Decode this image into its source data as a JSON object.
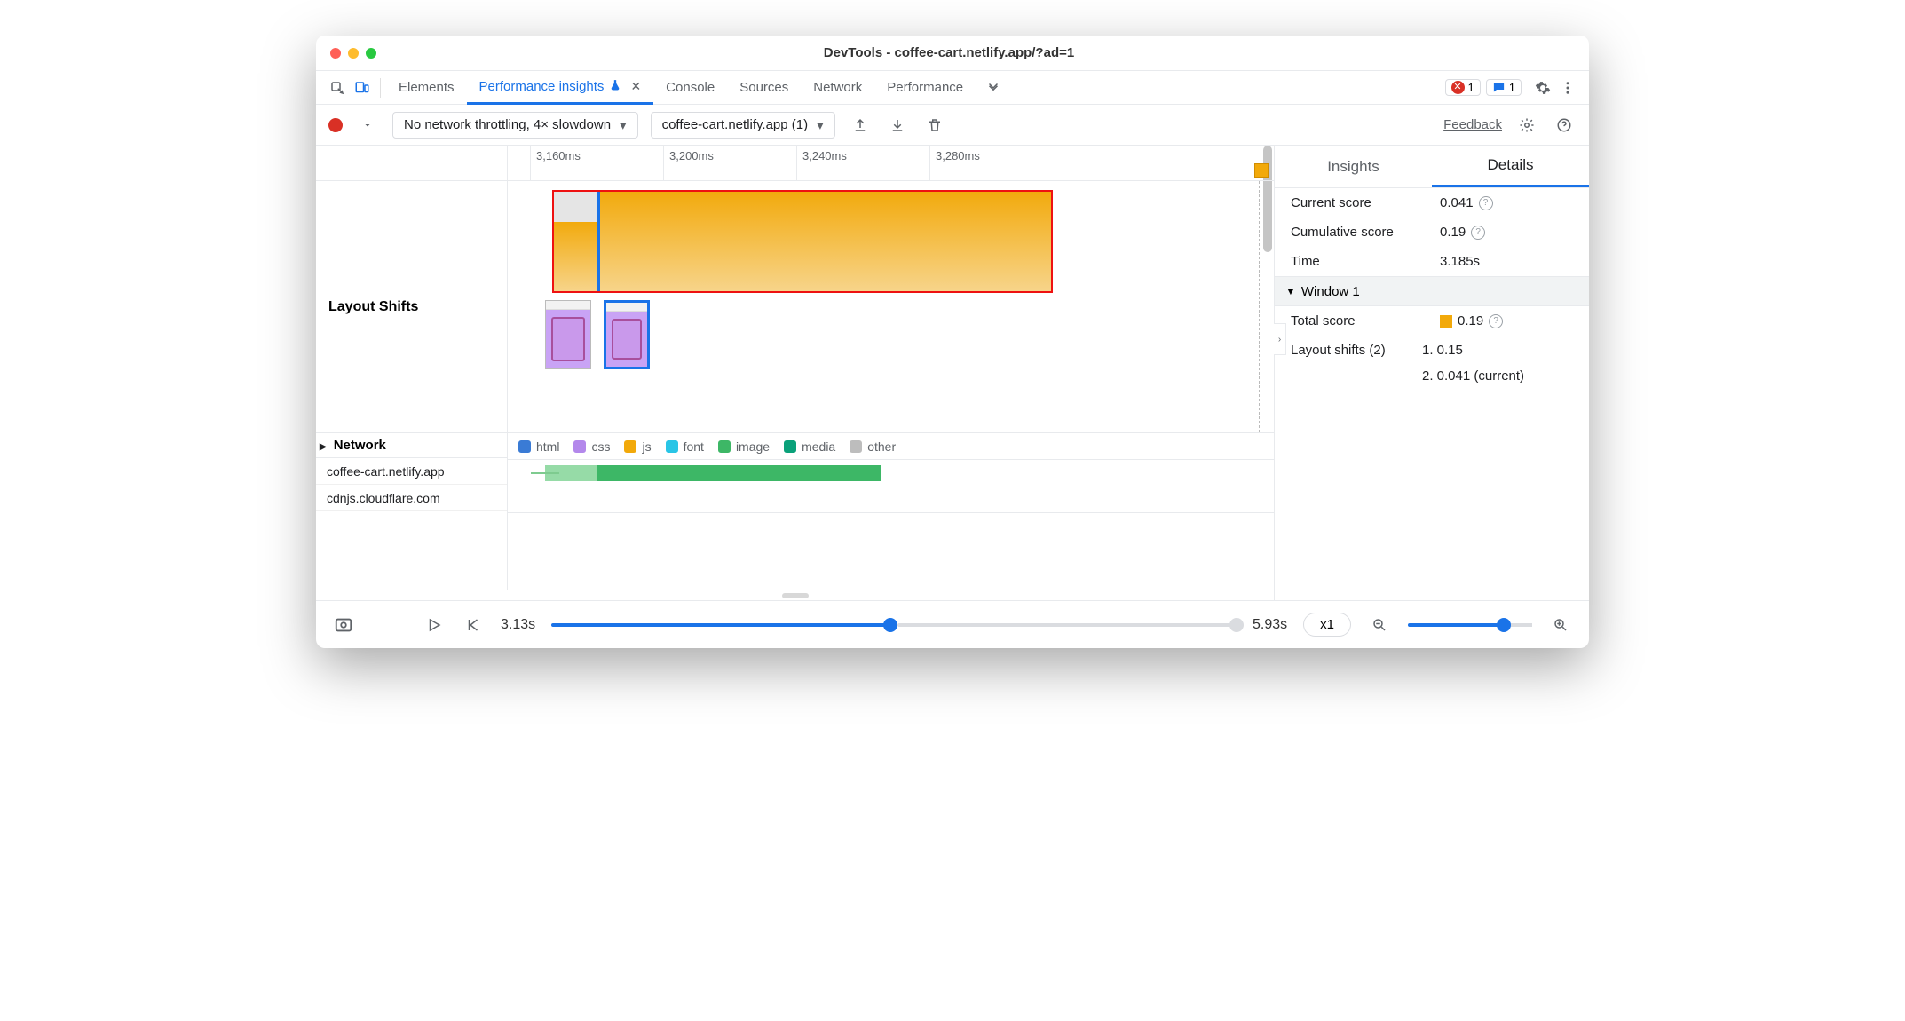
{
  "window": {
    "title": "DevTools - coffee-cart.netlify.app/?ad=1"
  },
  "tabs": {
    "elements": "Elements",
    "perf_insights": "Performance insights",
    "console": "Console",
    "sources": "Sources",
    "network": "Network",
    "performance": "Performance"
  },
  "badges": {
    "errors": "1",
    "messages": "1"
  },
  "toolbar": {
    "throttling": "No network throttling, 4× slowdown",
    "recording": "coffee-cart.netlify.app (1)",
    "feedback": "Feedback"
  },
  "ruler": {
    "ticks": [
      "3,160ms",
      "3,200ms",
      "3,240ms",
      "3,280ms"
    ]
  },
  "tracks": {
    "layout_shifts": "Layout Shifts",
    "network_header": "Network",
    "network_rows": [
      "coffee-cart.netlify.app",
      "cdnjs.cloudflare.com"
    ]
  },
  "legend": {
    "html": "html",
    "css": "css",
    "js": "js",
    "font": "font",
    "image": "image",
    "media": "media",
    "other": "other"
  },
  "legend_colors": {
    "html": "#3a7bd5",
    "css": "#b388eb",
    "js": "#f2a90a",
    "font": "#29c5e6",
    "image": "#3db766",
    "media": "#0aa17a",
    "other": "#bdbdbd"
  },
  "sidepanel": {
    "tab_insights": "Insights",
    "tab_details": "Details",
    "current_score_label": "Current score",
    "current_score_value": "0.041",
    "cumulative_score_label": "Cumulative score",
    "cumulative_score_value": "0.19",
    "time_label": "Time",
    "time_value": "3.185s",
    "window_header": "Window 1",
    "total_score_label": "Total score",
    "total_score_value": "0.19",
    "shifts_label": "Layout shifts (2)",
    "shift1": "1. 0.15",
    "shift2": "2. 0.041 (current)"
  },
  "footer": {
    "start": "3.13s",
    "end": "5.93s",
    "speed": "x1"
  }
}
